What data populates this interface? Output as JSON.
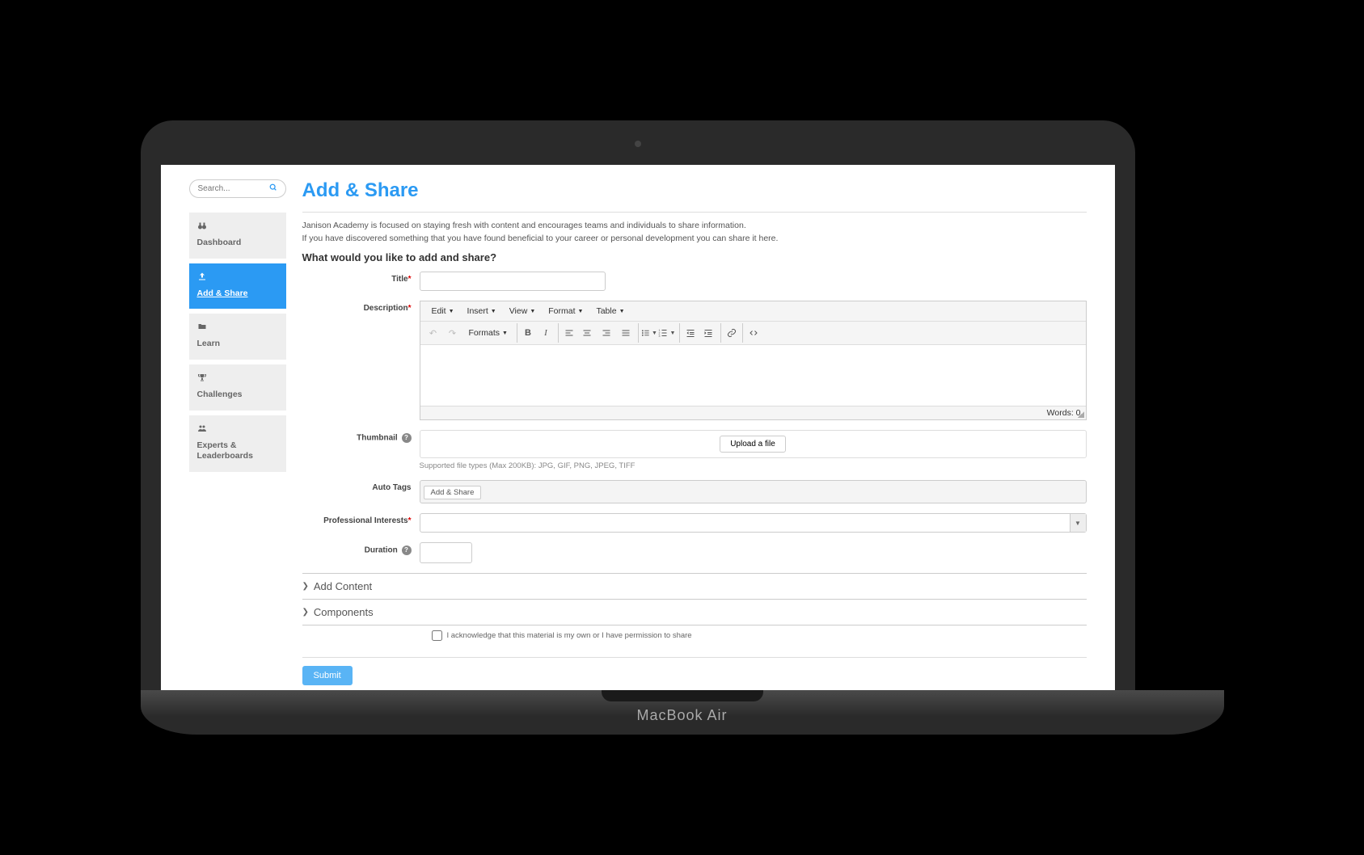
{
  "device_label": "MacBook Air",
  "search": {
    "placeholder": "Search..."
  },
  "nav": [
    {
      "label": "Dashboard",
      "icon": "binoculars"
    },
    {
      "label": "Add & Share",
      "icon": "upload"
    },
    {
      "label": "Learn",
      "icon": "folder"
    },
    {
      "label": "Challenges",
      "icon": "trophy"
    },
    {
      "label": "Experts & Leaderboards",
      "icon": "users"
    }
  ],
  "page": {
    "title": "Add & Share",
    "intro1": "Janison Academy is focused on staying fresh with content and encourages teams and individuals to share information.",
    "intro2": "If you have discovered something that you have found beneficial to your career or personal development you can share it here.",
    "question": "What would you like to add and share?"
  },
  "form": {
    "title_label": "Title",
    "description_label": "Description",
    "thumbnail_label": "Thumbnail",
    "upload_btn": "Upload a file",
    "thumbnail_hint": "Supported file types (Max 200KB): JPG, GIF, PNG, JPEG, TIFF",
    "autotags_label": "Auto Tags",
    "autotags_value": "Add & Share",
    "interests_label": "Professional Interests",
    "duration_label": "Duration",
    "ack_label": "I acknowledge that this material is my own or I have permission to share",
    "submit": "Submit"
  },
  "editor": {
    "menus": {
      "edit": "Edit",
      "insert": "Insert",
      "view": "View",
      "format": "Format",
      "table": "Table"
    },
    "formats_label": "Formats",
    "word_count": "Words: 0"
  },
  "collapsibles": {
    "add_content": "Add Content",
    "components": "Components"
  }
}
